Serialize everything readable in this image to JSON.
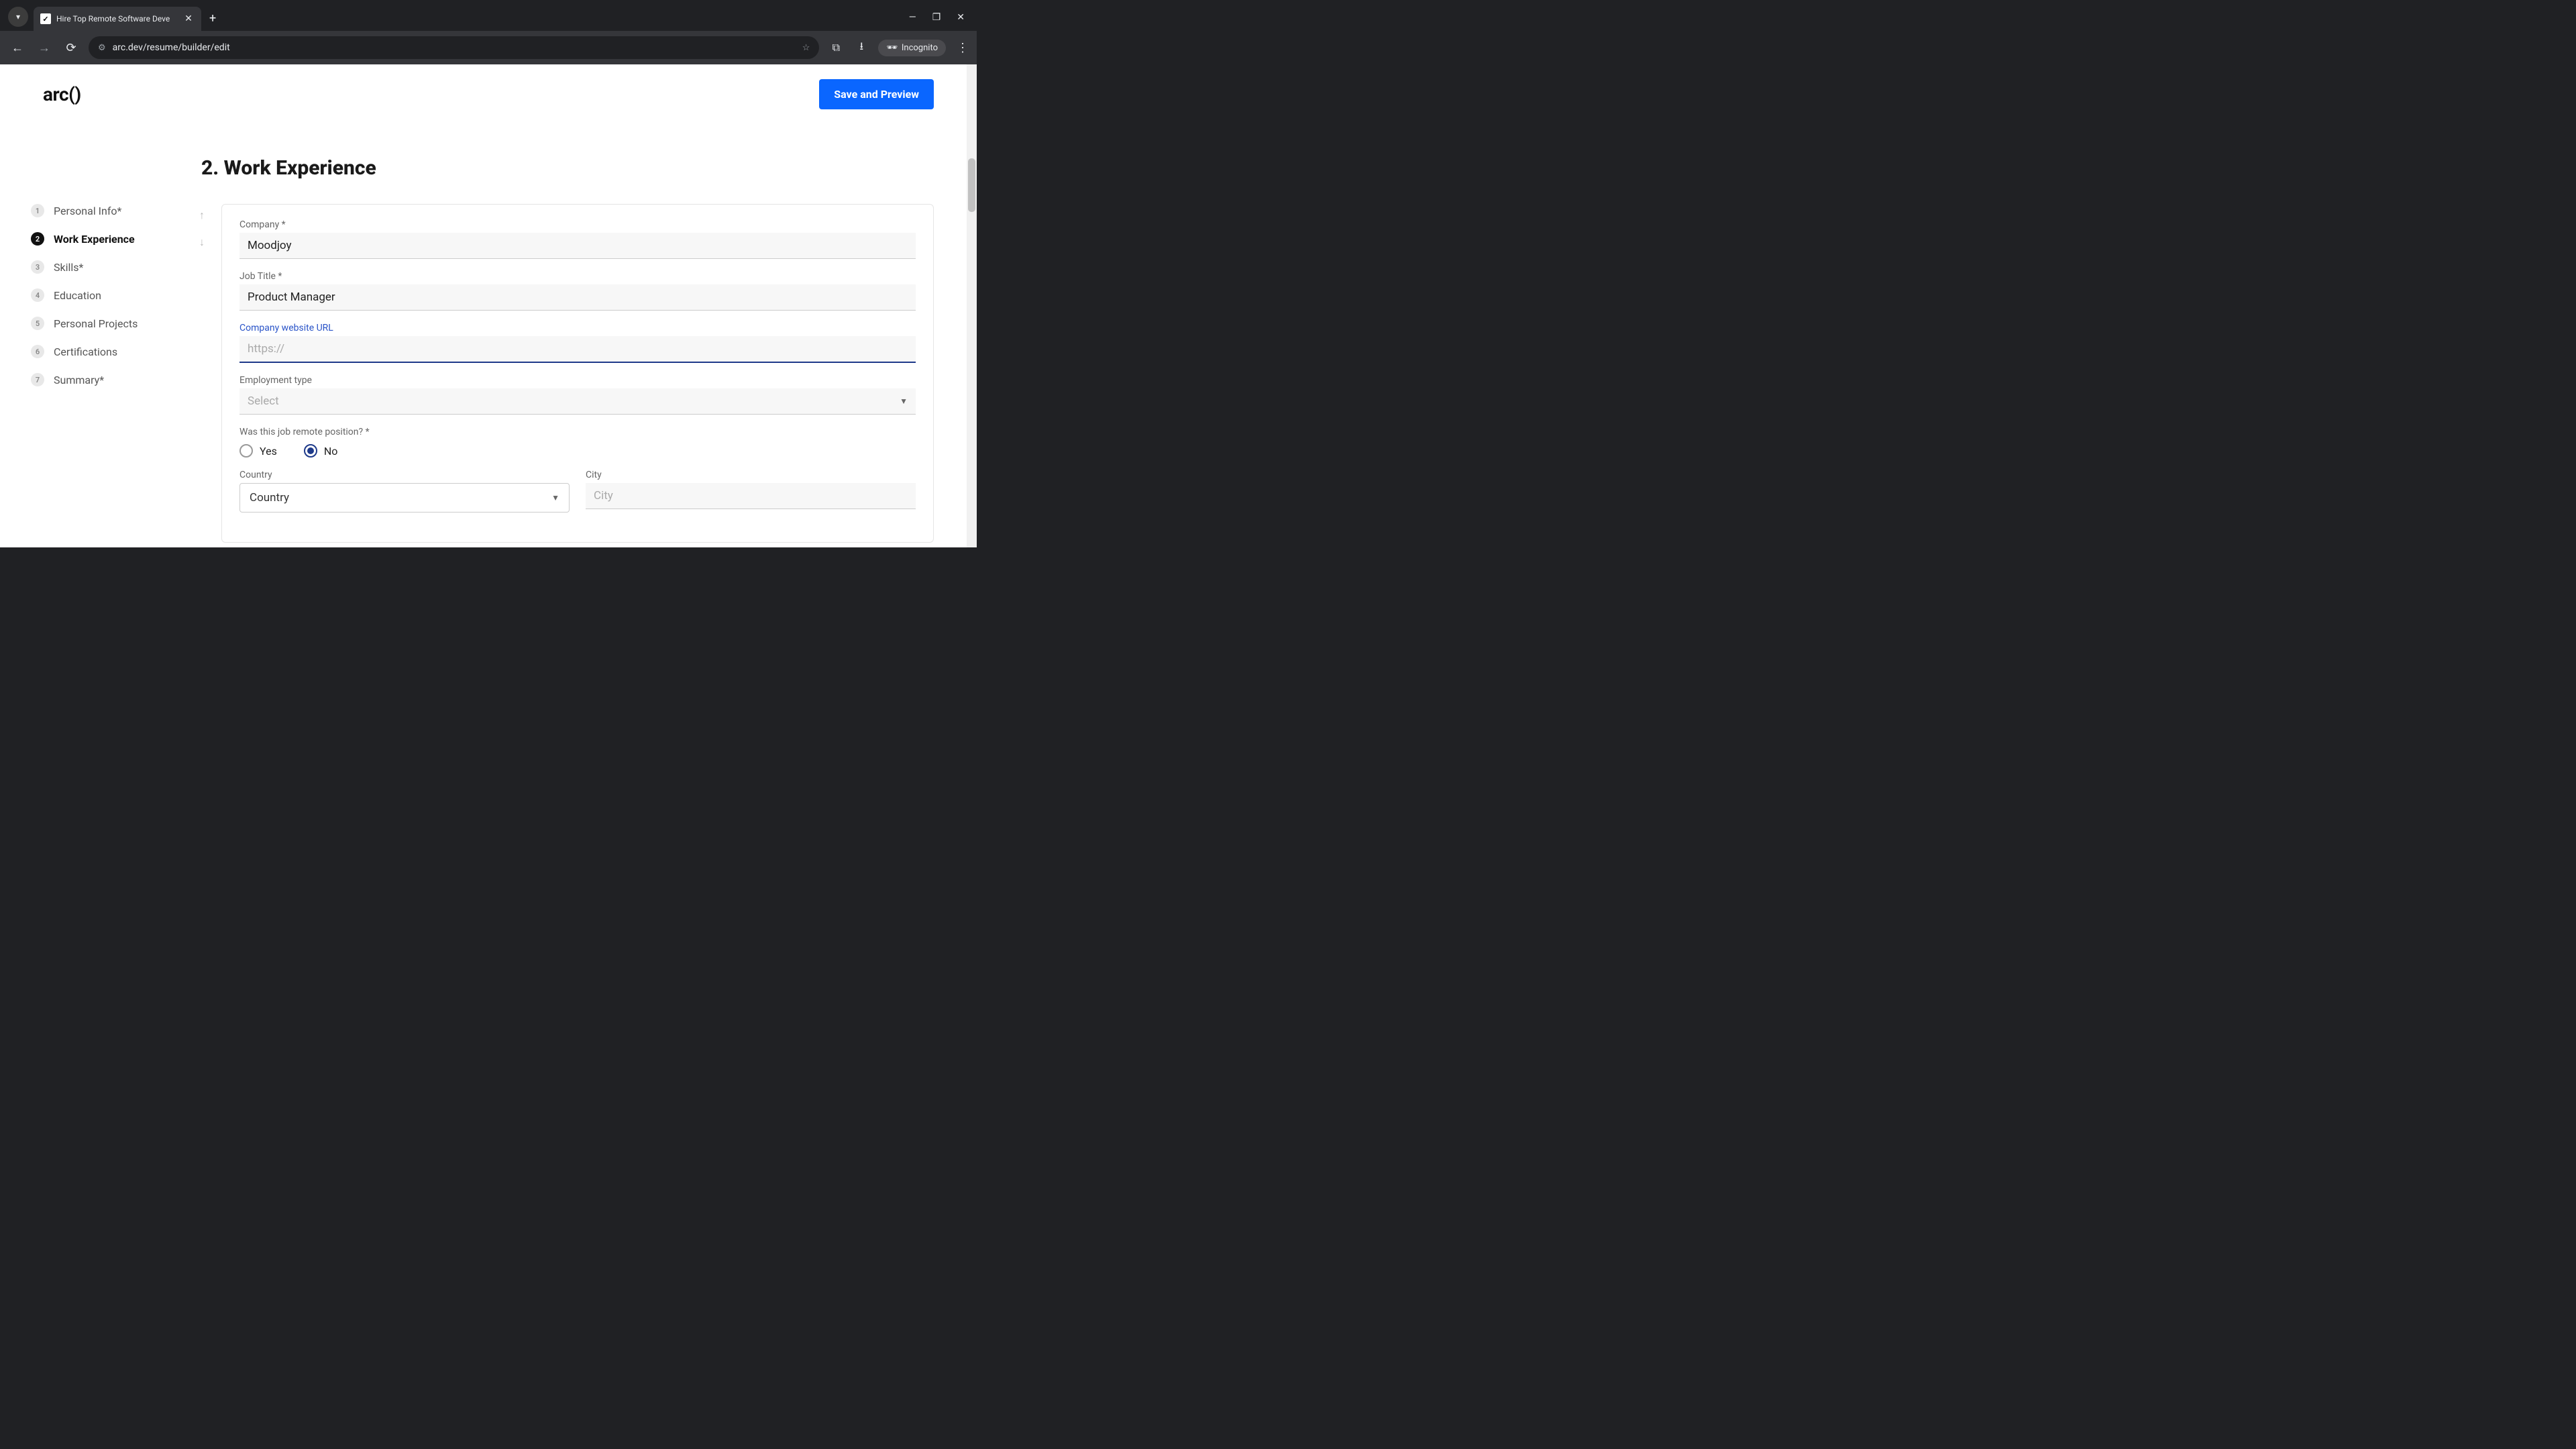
{
  "browser": {
    "tab_title": "Hire Top Remote Software Deve",
    "url": "arc.dev/resume/builder/edit",
    "incognito_label": "Incognito"
  },
  "header": {
    "logo": "arc()",
    "save_button": "Save and Preview"
  },
  "sidebar": {
    "items": [
      {
        "num": "1",
        "label": "Personal Info*"
      },
      {
        "num": "2",
        "label": "Work Experience"
      },
      {
        "num": "3",
        "label": "Skills*"
      },
      {
        "num": "4",
        "label": "Education"
      },
      {
        "num": "5",
        "label": "Personal Projects"
      },
      {
        "num": "6",
        "label": "Certifications"
      },
      {
        "num": "7",
        "label": "Summary*"
      }
    ]
  },
  "section": {
    "title": "2. Work Experience"
  },
  "form": {
    "company_label": "Company *",
    "company_value": "Moodjoy",
    "jobtitle_label": "Job Title *",
    "jobtitle_value": "Product Manager",
    "url_label": "Company website URL",
    "url_placeholder": "https://",
    "employment_label": "Employment type",
    "employment_placeholder": "Select",
    "remote_label": "Was this job remote position? *",
    "radio_yes": "Yes",
    "radio_no": "No",
    "country_label": "Country",
    "country_placeholder": "Country",
    "city_label": "City",
    "city_placeholder": "City"
  }
}
